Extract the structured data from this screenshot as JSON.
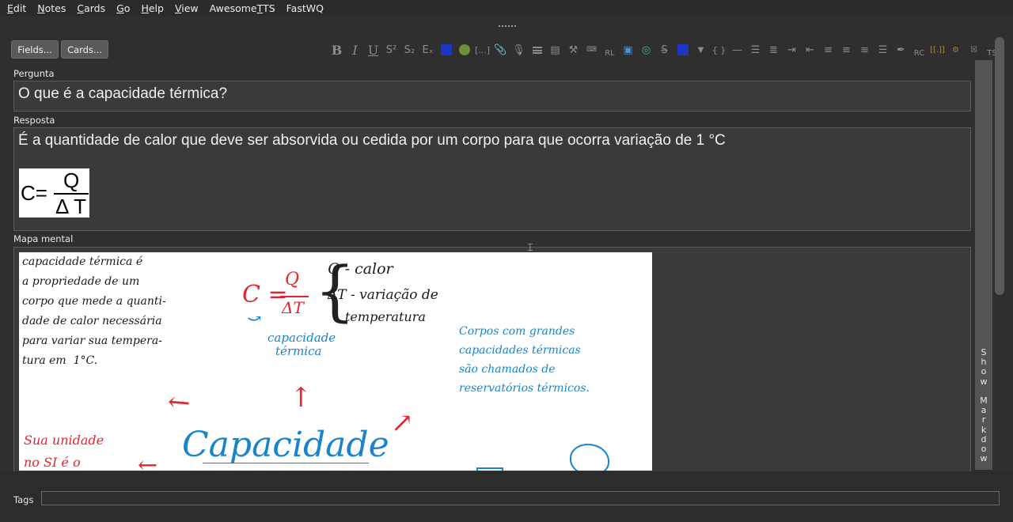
{
  "menu": [
    {
      "label": "Edit",
      "accel": "E",
      "rest": "dit"
    },
    {
      "label": "Notes",
      "accel": "N",
      "rest": "otes"
    },
    {
      "label": "Cards",
      "accel": "C",
      "rest": "ards"
    },
    {
      "label": "Go",
      "accel": "G",
      "rest": "o"
    },
    {
      "label": "Help",
      "accel": "H",
      "rest": "elp"
    },
    {
      "label": "View",
      "accel": "V",
      "rest": "iew"
    },
    {
      "label": "AwesomeTTS",
      "pre": "Awesome",
      "accel": "T",
      "rest": "TS"
    },
    {
      "label": "FastWQ",
      "accel": "",
      "rest": "FastWQ"
    }
  ],
  "buttons": {
    "fields": "Fields...",
    "cards": "Cards..."
  },
  "toolbar": {
    "bold": "B",
    "italic": "I",
    "underline": "U",
    "superscript": "S²",
    "subscript": "S₂",
    "clear": "Eₓ",
    "text_color": "#1f36c4",
    "highlight_color": "#6b8f3a",
    "cloze": "[...]",
    "rl": "RL",
    "rc": "RC",
    "ts": "TS",
    "braces": "{ }",
    "cloze_tag": "[[.]]"
  },
  "fields": {
    "pergunta": {
      "label": "Pergunta",
      "value": "O que é a capacidade térmica?"
    },
    "resposta": {
      "label": "Resposta",
      "value": "É a quantidade de calor que deve ser absorvida ou cedida por um corpo para que ocorra variação de 1 °C",
      "formula": {
        "lhs": "C=",
        "numerator": "Q",
        "denominator": "Δ T"
      }
    },
    "mapa": {
      "label": "Mapa mental"
    }
  },
  "mindmap": {
    "definition": [
      "capacidade térmica é",
      "a propriedade de um",
      "corpo que mede a quanti-",
      "dade de calor necessária",
      "para variar sua tempera-",
      "tura em  1°C."
    ],
    "formula_lhs": "C =",
    "formula_num": "Q",
    "formula_den": "ΔT",
    "legend_q": "Q - calor",
    "legend_dt": "ΔT - variação de",
    "legend_dt2": "temperatura",
    "c_label": [
      "capacidade",
      "térmica"
    ],
    "reservoirs": [
      "Corpos com grandes",
      "capacidades térmicas",
      "são chamados de",
      "reservatórios térmicos."
    ],
    "unit": [
      "Sua unidade",
      "no SI é o"
    ],
    "center": "Capacidade"
  },
  "side_panel": {
    "label": "Show Markdow"
  },
  "tags": {
    "label": "Tags",
    "value": ""
  }
}
